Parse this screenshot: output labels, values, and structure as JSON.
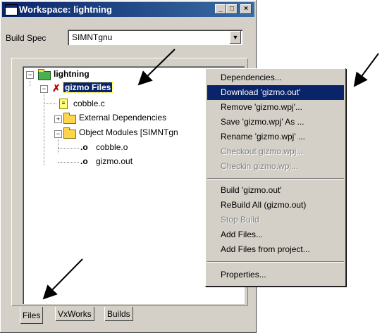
{
  "window": {
    "title": "Workspace: lightning",
    "min": "_",
    "max": "□",
    "close": "×"
  },
  "build_spec": {
    "label": "Build Spec",
    "value": "SIMNTgnu",
    "dropdown": "▼"
  },
  "tree": {
    "root": "lightning",
    "project": "gizmo Files",
    "items": [
      "cobble.c",
      "External Dependencies",
      "Object Modules [SIMNTgn",
      "cobble.o",
      "gizmo.out"
    ],
    "expand_minus": "−",
    "expand_plus": "+"
  },
  "tabs": [
    "Files",
    "VxWorks",
    "Builds"
  ],
  "context_menu": {
    "group1": [
      {
        "label": "Dependencies...",
        "state": "normal"
      },
      {
        "label": "Download 'gizmo.out'",
        "state": "highlighted"
      },
      {
        "label": "Remove 'gizmo.wpj'...",
        "state": "normal"
      },
      {
        "label": "Save 'gizmo.wpj' As ...",
        "state": "normal"
      },
      {
        "label": "Rename 'gizmo.wpj' ...",
        "state": "normal"
      },
      {
        "label": "Checkout  gizmo.wpj...",
        "state": "disabled"
      },
      {
        "label": "Checkin gizmo.wpj...",
        "state": "disabled"
      }
    ],
    "group2": [
      {
        "label": "Build 'gizmo.out'",
        "state": "normal"
      },
      {
        "label": "ReBuild All (gizmo.out)",
        "state": "normal"
      },
      {
        "label": "Stop Build",
        "state": "disabled"
      },
      {
        "label": "Add Files...",
        "state": "normal"
      },
      {
        "label": "Add Files from project...",
        "state": "normal"
      }
    ],
    "group3": [
      {
        "label": "Properties...",
        "state": "normal"
      }
    ]
  },
  "colors": {
    "highlight": "#0a246a",
    "face": "#d4d0c8",
    "title_start": "#0a246a",
    "title_end": "#3a6ea5"
  },
  "icons": [
    "app-icon",
    "workspace-icon",
    "project-icon",
    "file-icon",
    "folder-icon",
    "object-file-icon"
  ]
}
